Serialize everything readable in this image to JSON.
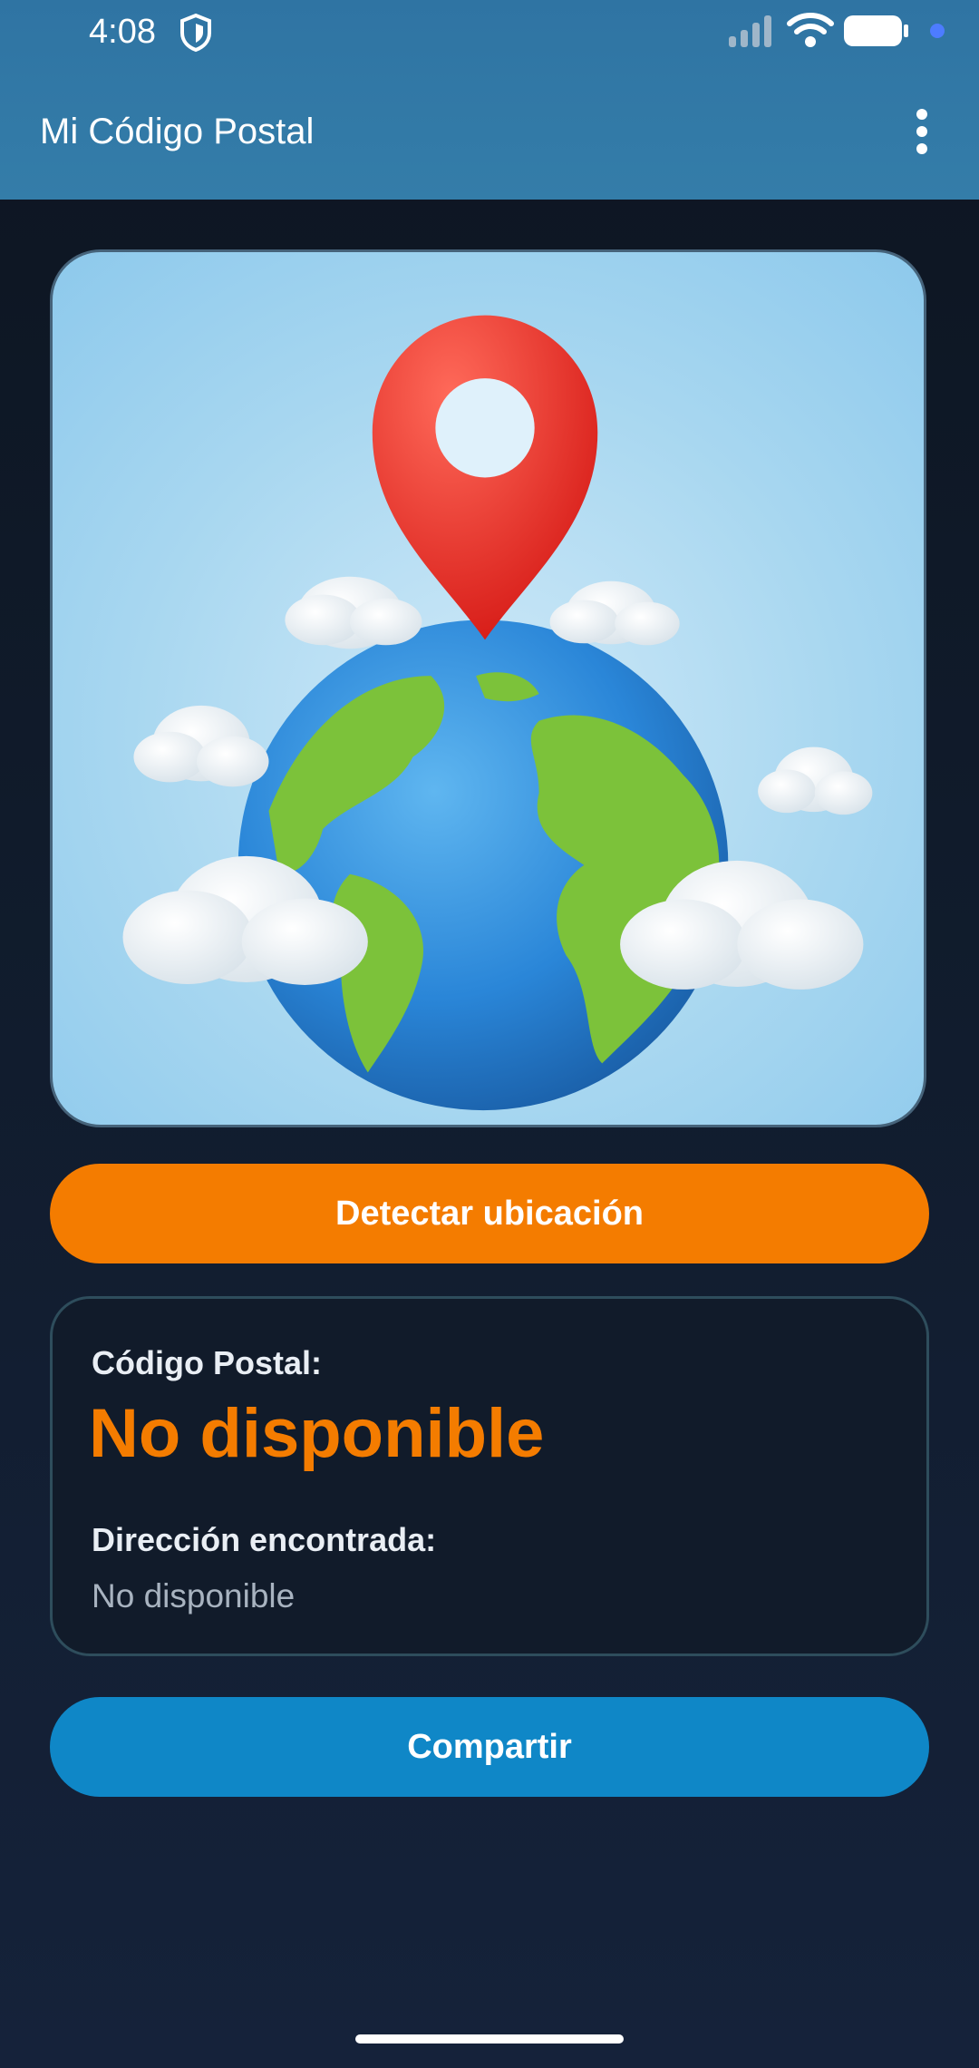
{
  "status_bar": {
    "time": "4:08"
  },
  "app_bar": {
    "title": "Mi Código Postal",
    "menu_icon": "more-vert-icon"
  },
  "hero": {
    "image_description_icon": "location-pin-on-globe-illustration"
  },
  "actions": {
    "detect_label": "Detectar ubicación",
    "share_label": "Compartir"
  },
  "result": {
    "postal_label": "Código Postal:",
    "postal_value": "No disponible",
    "address_label": "Dirección encontrada:",
    "address_value": "No disponible"
  },
  "colors": {
    "accent_orange": "#f47c00",
    "share_blue": "#0f87c7",
    "app_bar": "#347da9"
  }
}
